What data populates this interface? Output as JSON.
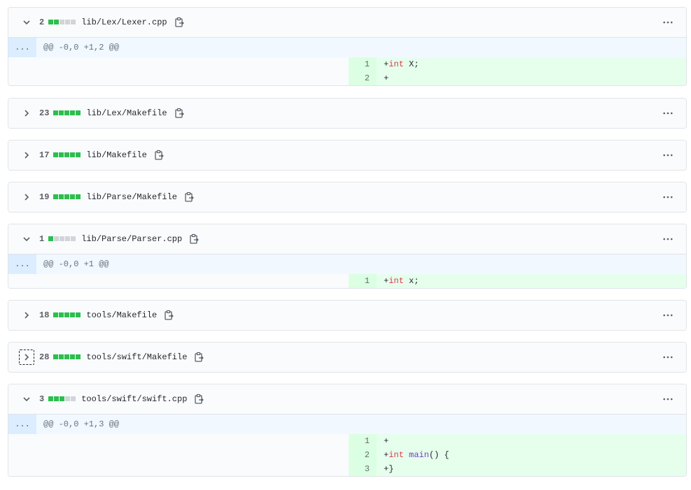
{
  "files": [
    {
      "expanded": true,
      "changes": "2",
      "path": "lib/Lex/Lexer.cpp",
      "bar": [
        "add",
        "add",
        "neu",
        "neu",
        "neu"
      ],
      "hunk": "@@ -0,0 +1,2 @@",
      "lines": [
        {
          "num": "1",
          "parts": [
            {
              "t": "+",
              "c": ""
            },
            {
              "t": "int",
              "c": "kw"
            },
            {
              "t": " X;",
              "c": ""
            }
          ]
        },
        {
          "num": "2",
          "parts": [
            {
              "t": "+",
              "c": ""
            }
          ]
        }
      ]
    },
    {
      "expanded": false,
      "changes": "23",
      "path": "lib/Lex/Makefile",
      "bar": [
        "add",
        "add",
        "add",
        "add",
        "add"
      ]
    },
    {
      "expanded": false,
      "changes": "17",
      "path": "lib/Makefile",
      "bar": [
        "add",
        "add",
        "add",
        "add",
        "add"
      ]
    },
    {
      "expanded": false,
      "changes": "19",
      "path": "lib/Parse/Makefile",
      "bar": [
        "add",
        "add",
        "add",
        "add",
        "add"
      ]
    },
    {
      "expanded": true,
      "changes": "1",
      "path": "lib/Parse/Parser.cpp",
      "bar": [
        "add",
        "neu",
        "neu",
        "neu",
        "neu"
      ],
      "hunk": "@@ -0,0 +1 @@",
      "lines": [
        {
          "num": "1",
          "parts": [
            {
              "t": "+",
              "c": ""
            },
            {
              "t": "int",
              "c": "kw"
            },
            {
              "t": " x;",
              "c": ""
            }
          ]
        }
      ]
    },
    {
      "expanded": false,
      "changes": "18",
      "path": "tools/Makefile",
      "bar": [
        "add",
        "add",
        "add",
        "add",
        "add"
      ]
    },
    {
      "expanded": false,
      "changes": "28",
      "path": "tools/swift/Makefile",
      "bar": [
        "add",
        "add",
        "add",
        "add",
        "add"
      ],
      "focused": true
    },
    {
      "expanded": true,
      "changes": "3",
      "path": "tools/swift/swift.cpp",
      "bar": [
        "add",
        "add",
        "add",
        "neu",
        "neu"
      ],
      "hunk": "@@ -0,0 +1,3 @@",
      "lines": [
        {
          "num": "1",
          "parts": [
            {
              "t": "+",
              "c": ""
            }
          ]
        },
        {
          "num": "2",
          "parts": [
            {
              "t": "+",
              "c": ""
            },
            {
              "t": "int",
              "c": "kw"
            },
            {
              "t": " ",
              "c": ""
            },
            {
              "t": "main",
              "c": "fn"
            },
            {
              "t": "() {",
              "c": ""
            }
          ]
        },
        {
          "num": "3",
          "parts": [
            {
              "t": "+}",
              "c": ""
            }
          ]
        }
      ]
    }
  ],
  "hunk_expander_label": "...",
  "icons": {
    "toggle_open": "chevron-down-icon",
    "toggle_closed": "chevron-right-icon",
    "copy": "clipboard-copy-icon",
    "menu": "kebab-horizontal-icon"
  },
  "colors": {
    "addition_block": "#2cbe4e",
    "neutral_block": "#d1d5da",
    "added_line_bg": "#e6ffed",
    "added_num_bg": "#cdffd8",
    "hunk_bg": "#f1f8ff",
    "keyword": "#d73a49",
    "function": "#6f42c1"
  }
}
